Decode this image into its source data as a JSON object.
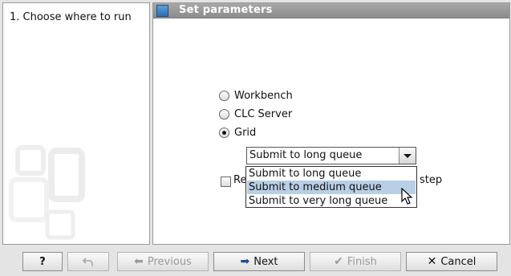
{
  "steps": [
    {
      "label": "1.  Choose where to run"
    }
  ],
  "panel": {
    "title": "Set parameters"
  },
  "run_options": [
    {
      "label": "Workbench",
      "selected": false
    },
    {
      "label": "CLC Server",
      "selected": false
    },
    {
      "label": "Grid",
      "selected": true
    }
  ],
  "queue_combo": {
    "value": "Submit to long queue"
  },
  "queue_options": [
    {
      "label": "Submit to long queue",
      "highlighted": false
    },
    {
      "label": "Submit to medium queue",
      "highlighted": true
    },
    {
      "label": "Submit to very long queue",
      "highlighted": false
    }
  ],
  "checkbox": {
    "label_visible_start": "Re",
    "label_visible_end": "step",
    "checked": false
  },
  "buttons": {
    "help": "?",
    "reset_icon": "undo-icon",
    "previous": "Previous",
    "next": "Next",
    "finish": "Finish",
    "cancel": "Cancel"
  },
  "colors": {
    "header": "#9a9a9a",
    "highlight": "#b8cfe5",
    "accent": "#2d6fb0"
  }
}
